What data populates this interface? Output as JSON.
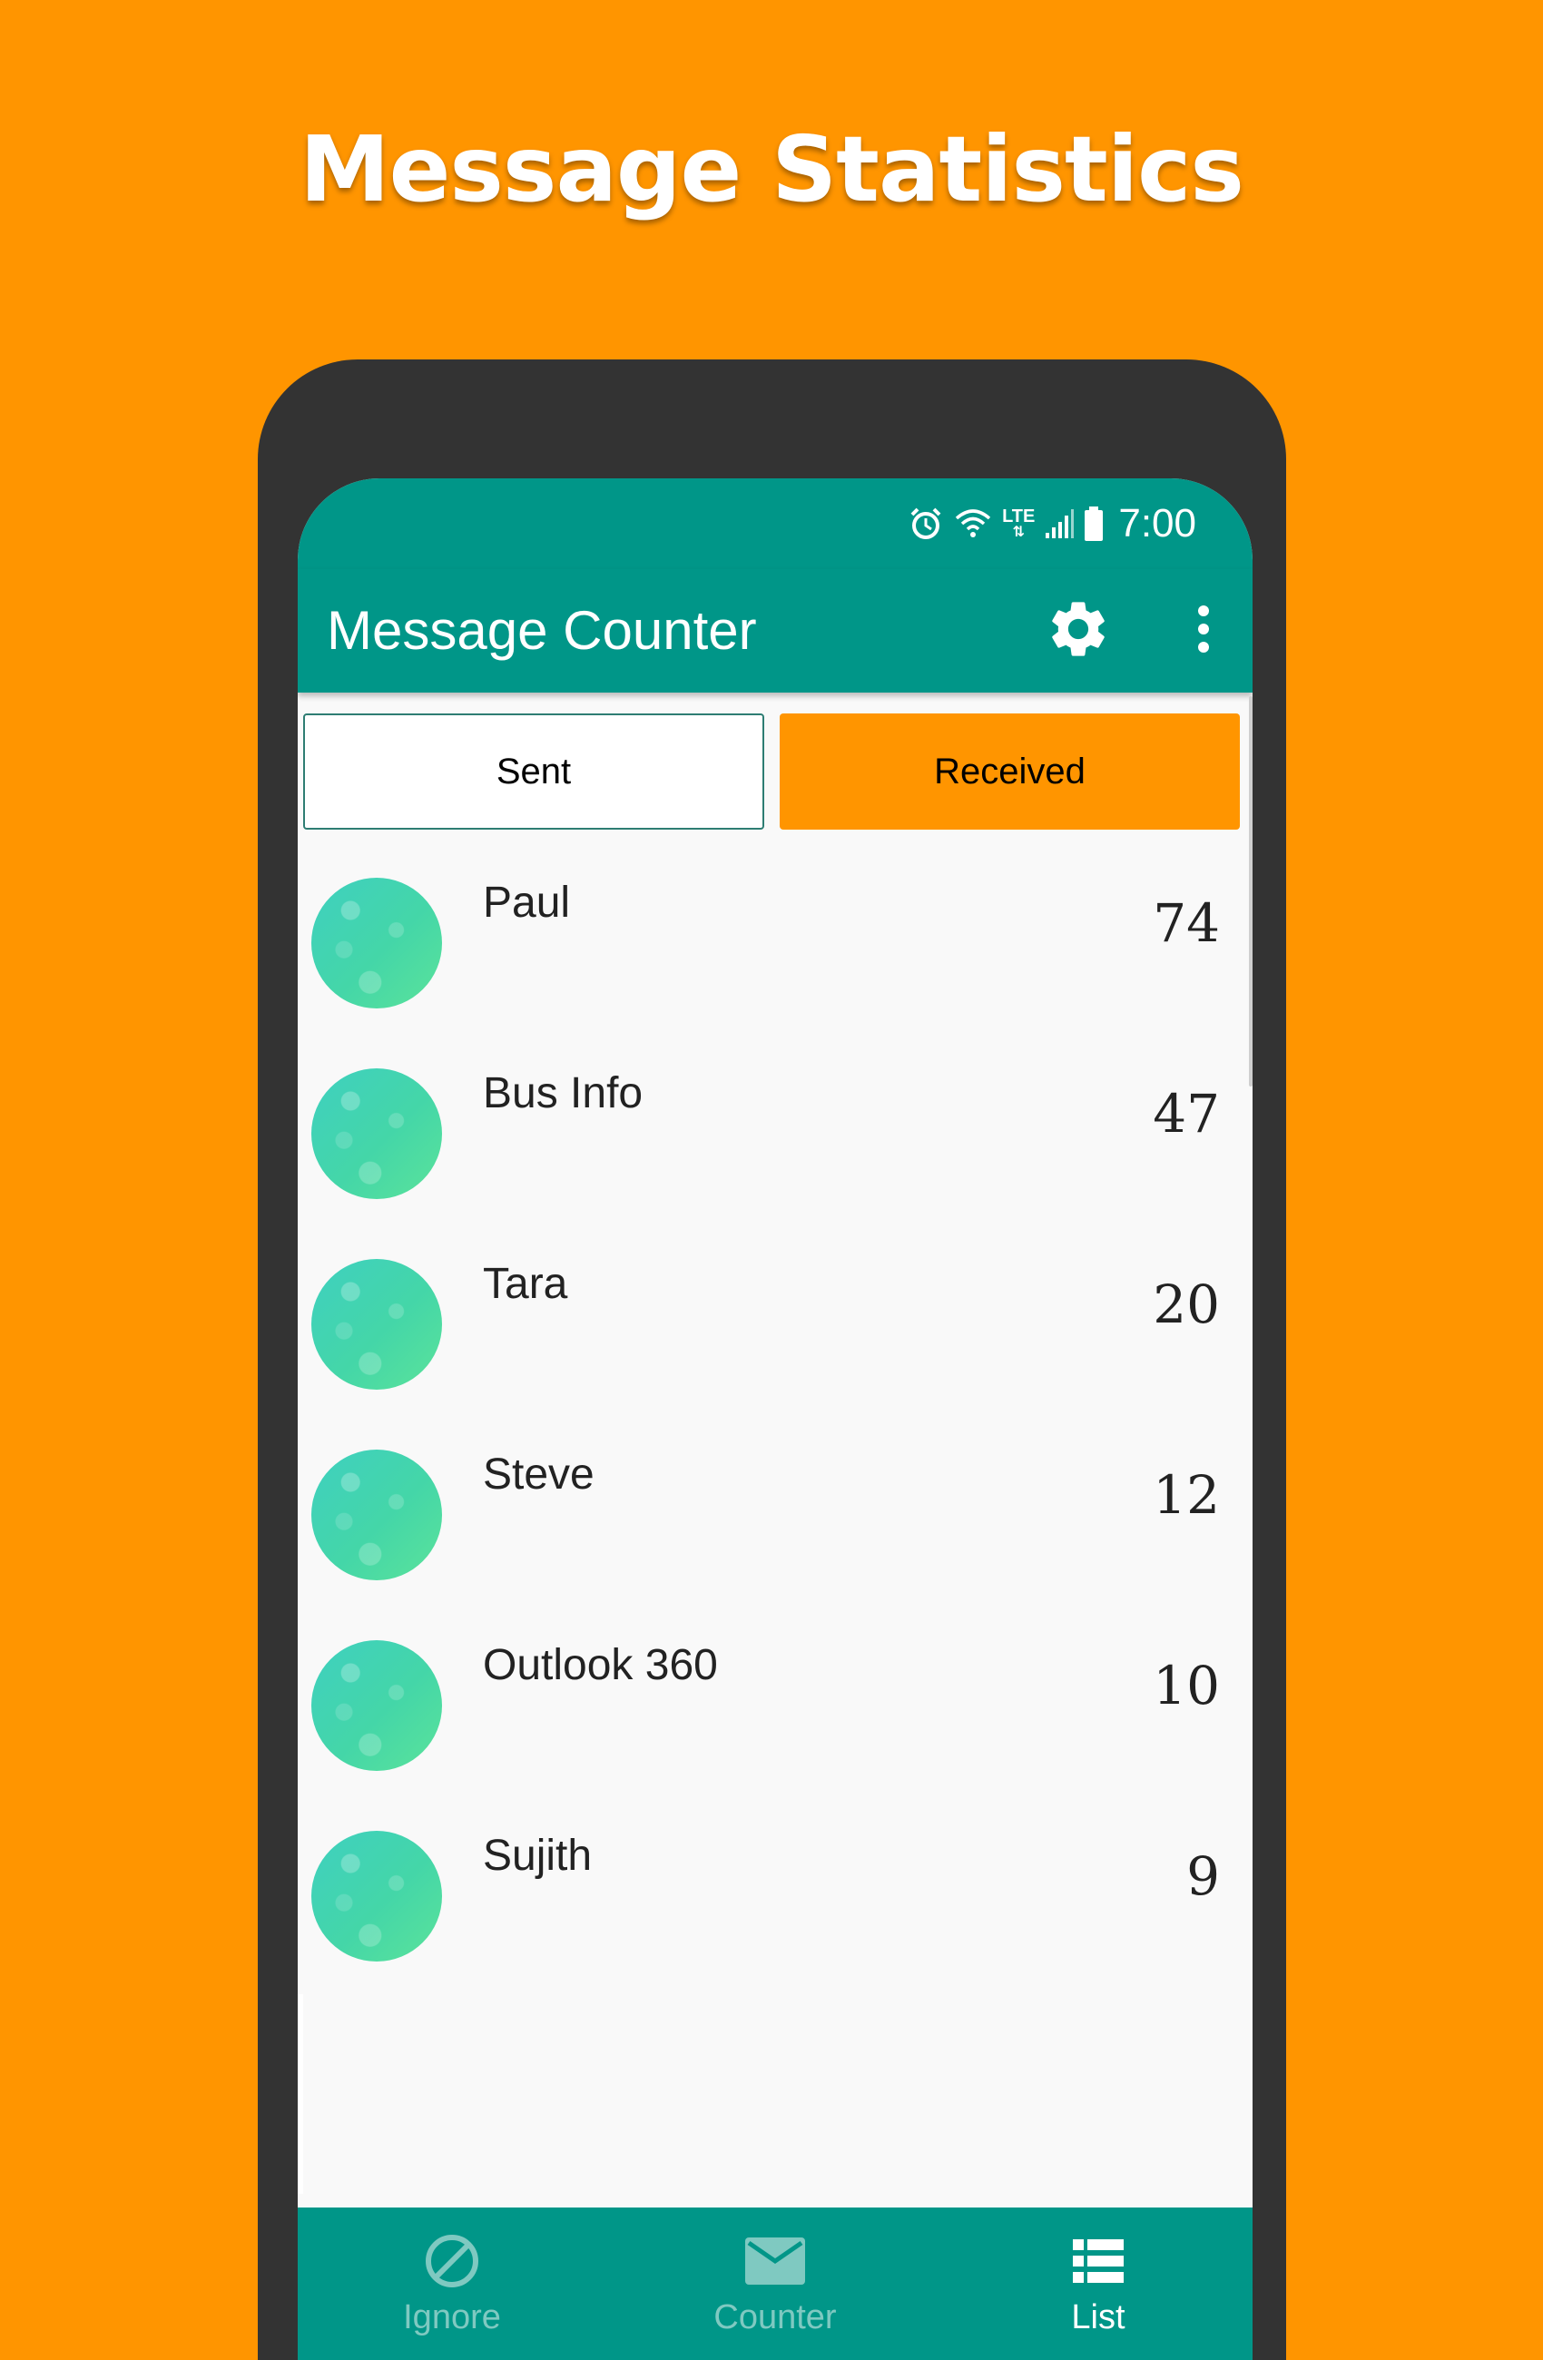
{
  "promo": {
    "headline": "Message Statistics"
  },
  "status_bar": {
    "time": "7:00",
    "network": "LTE",
    "icons": [
      "alarm-icon",
      "wifi-icon",
      "lte-icon",
      "signal-icon",
      "battery-icon"
    ]
  },
  "app_bar": {
    "title": "Message Counter",
    "actions": [
      "gear-icon",
      "more-vert-icon"
    ]
  },
  "toggle": {
    "sent_label": "Sent",
    "received_label": "Received",
    "selected": "Received"
  },
  "contacts": [
    {
      "name": "Paul",
      "count": "74"
    },
    {
      "name": "Bus Info",
      "count": "47"
    },
    {
      "name": "Tara",
      "count": "20"
    },
    {
      "name": "Steve",
      "count": "12"
    },
    {
      "name": "Outlook 360",
      "count": "10"
    },
    {
      "name": "Sujith",
      "count": "9"
    }
  ],
  "bottom_nav": {
    "items": [
      {
        "label": "Ignore",
        "icon": "block-icon",
        "active": false
      },
      {
        "label": "Counter",
        "icon": "mail-icon",
        "active": false
      },
      {
        "label": "List",
        "icon": "list-icon",
        "active": true
      }
    ]
  },
  "colors": {
    "background": "#FF9500",
    "primary": "#009688",
    "accent": "#FF9500",
    "phone_frame": "#333333"
  }
}
